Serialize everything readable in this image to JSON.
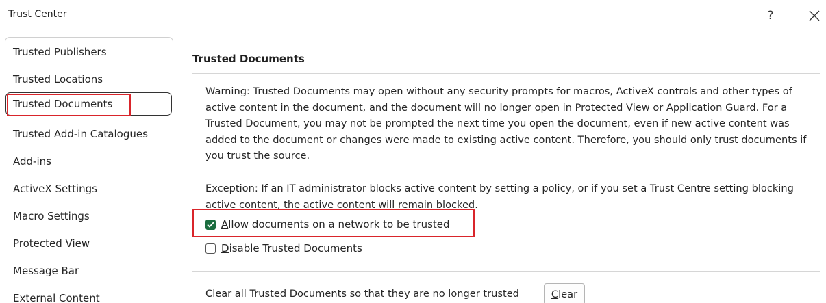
{
  "window": {
    "title": "Trust Center",
    "help_label": "?",
    "close_icon": "close-icon"
  },
  "sidebar": {
    "items": [
      {
        "label": "Trusted Publishers",
        "selected": false
      },
      {
        "label": "Trusted Locations",
        "selected": false
      },
      {
        "label": "Trusted Documents",
        "selected": true
      },
      {
        "label": "Trusted Add-in Catalogues",
        "selected": false
      },
      {
        "label": "Add-ins",
        "selected": false
      },
      {
        "label": "ActiveX Settings",
        "selected": false
      },
      {
        "label": "Macro Settings",
        "selected": false
      },
      {
        "label": "Protected View",
        "selected": false
      },
      {
        "label": "Message Bar",
        "selected": false
      },
      {
        "label": "External Content",
        "selected": false
      }
    ]
  },
  "main": {
    "section_title": "Trusted Documents",
    "warning_text": "Warning: Trusted Documents may open without any security prompts for macros, ActiveX controls and other types of active content in the document, and the document will no longer open in Protected View or Application Guard. For a Trusted Document, you may not be prompted the next time you open the document, even if new active content was added to the document or changes were made to existing active content. Therefore, you should only trust documents if you trust the source.",
    "exception_text": "Exception: If an IT administrator blocks active content by setting a policy, or if you set a Trust Centre setting blocking active content, the active content will remain blocked.",
    "checkboxes": [
      {
        "access_key": "A",
        "label_rest": "llow documents on a network to be trusted",
        "checked": true
      },
      {
        "access_key": "D",
        "label_rest": "isable Trusted Documents",
        "checked": false
      }
    ],
    "clear_text": "Clear all Trusted Documents so that they are no longer trusted",
    "clear_button": {
      "access_key": "C",
      "label_rest": "lear"
    }
  },
  "colors": {
    "highlight_red": "#d9252b",
    "checkbox_green": "#1b6d3f"
  }
}
